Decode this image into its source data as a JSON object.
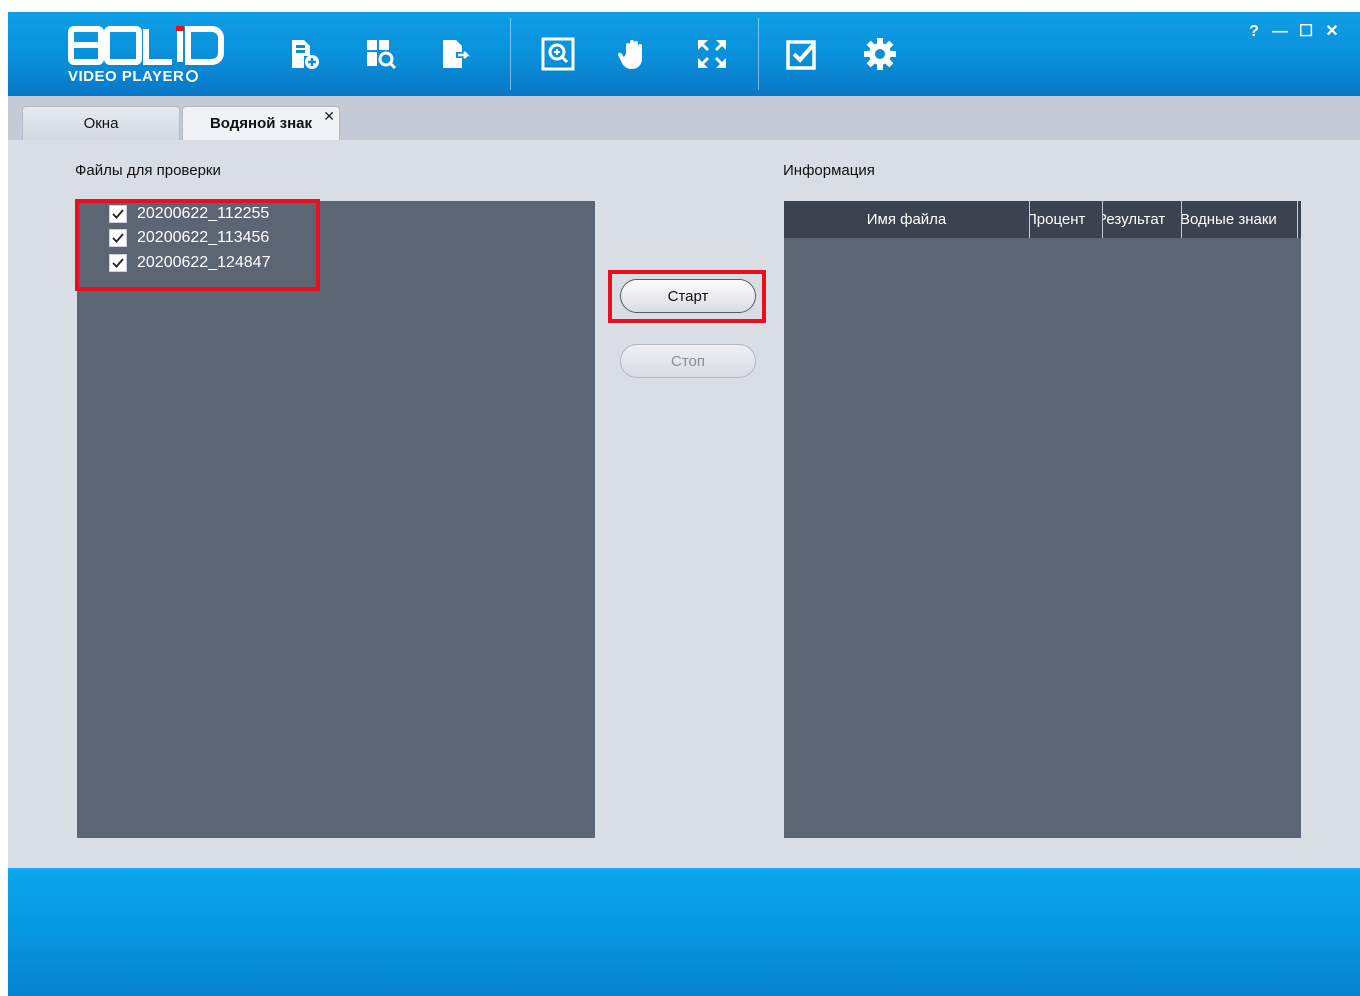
{
  "app": {
    "logo_word": "BOLID",
    "logo_subtitle": "VIDEO PLAYER",
    "accent_color": "#0a8fd9",
    "highlight_color": "#e8101c"
  },
  "toolbar": {
    "icons": [
      "add-file-icon",
      "search-file-icon",
      "export-file-icon",
      "zoom-icon",
      "hand-icon",
      "fullscreen-icon",
      "checklist-icon",
      "settings-icon"
    ]
  },
  "window_controls": {
    "help": "?",
    "minimize": "—",
    "maximize": "☐",
    "close": "✕"
  },
  "tabs": [
    {
      "label": "Окна",
      "active": false
    },
    {
      "label": "Водяной знак",
      "active": true,
      "close": "✕"
    }
  ],
  "files_section": {
    "title": "Файлы для проверки",
    "files": [
      {
        "name": "20200622_112255",
        "checked": true
      },
      {
        "name": "20200622_113456",
        "checked": true
      },
      {
        "name": "20200622_124847",
        "checked": true
      }
    ]
  },
  "actions": {
    "start_label": "Старт",
    "stop_label": "Стоп"
  },
  "info_section": {
    "title": "Информация",
    "columns": [
      "Имя файла",
      "Процент",
      "Результат",
      "Водные знаки"
    ]
  }
}
